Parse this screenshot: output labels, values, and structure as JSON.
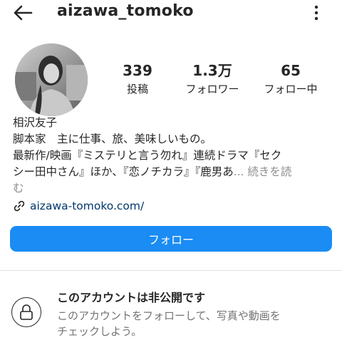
{
  "header": {
    "username": "aizawa_tomoko",
    "back_icon": "arrow-left-icon",
    "more_icon": "more-vertical-icon"
  },
  "profile": {
    "avatar": "profile-photo-avatar",
    "stats": [
      {
        "value": "339",
        "label": "投稿"
      },
      {
        "value": "1.3万",
        "label": "フォロワー"
      },
      {
        "value": "65",
        "label": "フォロー中"
      }
    ]
  },
  "bio": {
    "name": "相沢友子",
    "line1": "脚本家　主に仕事、旅、美味しいもの。",
    "line2": "最新作/映画『ミステリと言う勿れ』連続ドラマ『セク",
    "line3": "シー田中さん』ほか、『恋ノチカラ』『鹿男あ",
    "ellipsis": "...",
    "more": "続きを読",
    "line4": "む",
    "link": "aizawa-tomoko.com/"
  },
  "actions": {
    "follow_label": "フォロー"
  },
  "private_notice": {
    "title": "このアカウントは非公開です",
    "desc_line1": "このアカウントをフォローして、写真や動画を",
    "desc_line2": "チェックしよう。"
  },
  "colors": {
    "accent": "#1a8cf4",
    "link": "#00376b",
    "muted": "#737373"
  }
}
